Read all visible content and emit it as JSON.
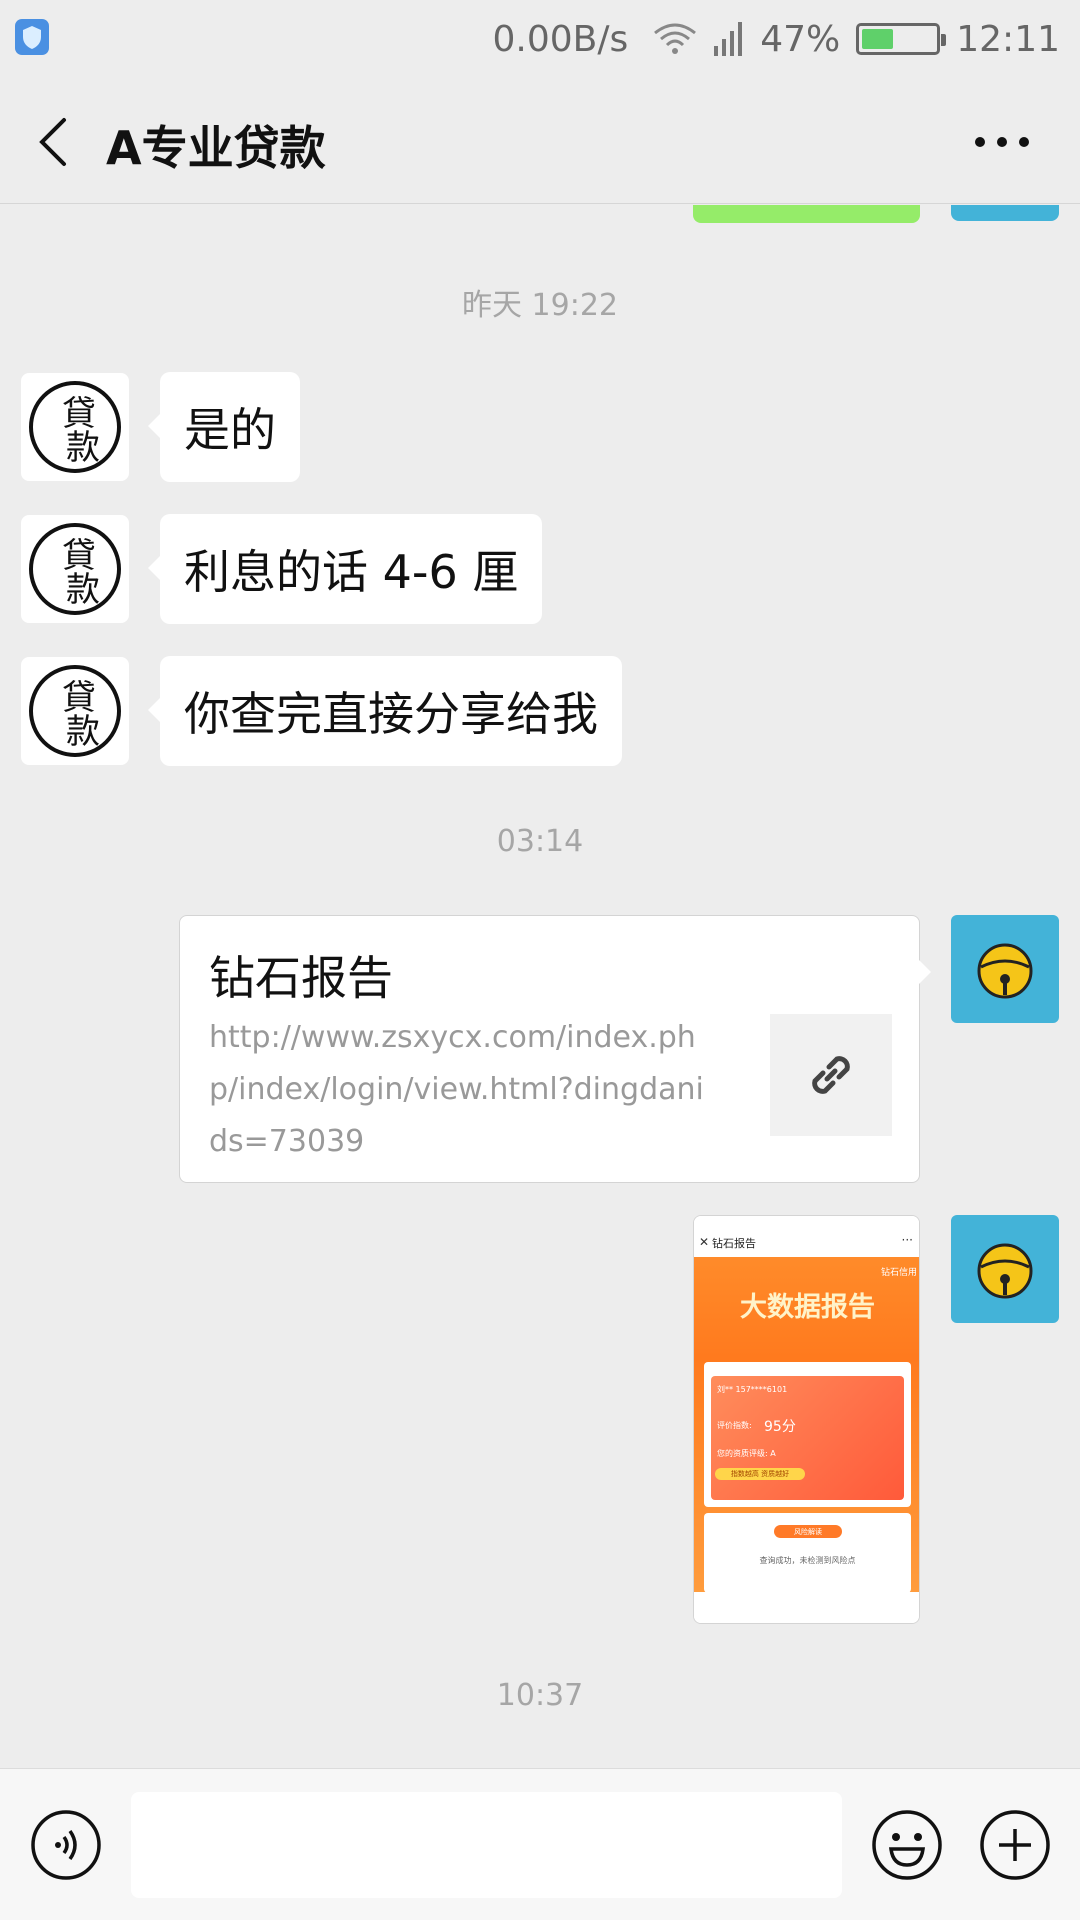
{
  "status_bar": {
    "net_speed": "0.00B/s",
    "battery_percent": "47%",
    "battery_level": 0.47,
    "time": "12:11"
  },
  "header": {
    "title": "A专业贷款",
    "back_icon": "chevron-left-icon",
    "more_icon": "more-dots-icon"
  },
  "messages": {
    "ts1": "昨天 19:22",
    "m1": "是的",
    "m2": "利息的话 4-6 厘",
    "m3": "你查完直接分享给我",
    "ts2": "03:14",
    "link": {
      "title": "钻石报告",
      "url": "http://www.zsxycx.com/index.php/index/login/view.html?dingdanids=73039",
      "icon": "link-icon"
    },
    "shot": {
      "page_title": "钻石报告",
      "brand": "钻石信用",
      "heading": "大数据报告",
      "line1": "刘** 157****6101",
      "score_label": "评价指数:",
      "score": "95分",
      "grade": "您的资质评级: A",
      "button": "指数越高 资质越好",
      "pill": "风险解读",
      "note": "查询成功，未检测到风险点"
    },
    "ts3": "10:37"
  },
  "avatar_left_text": "貸款",
  "avatar_right_icon": "bell-icon",
  "input_bar": {
    "voice_icon": "voice-icon",
    "emoji_icon": "emoji-icon",
    "plus_icon": "plus-icon",
    "placeholder": ""
  },
  "colors": {
    "background": "#ededed",
    "bubble_self_green": "#95ec69",
    "avatar_self_blue": "#43b3d8"
  }
}
